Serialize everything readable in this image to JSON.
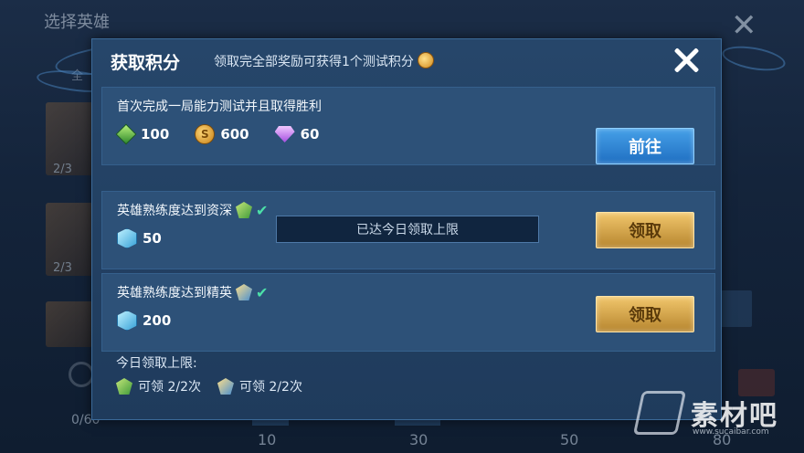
{
  "background": {
    "title": "选择英雄",
    "tab_partial": "全",
    "card_counts": [
      "2/3",
      "2/3"
    ],
    "progress_left": "0/60",
    "scale_labels": [
      "10",
      "30",
      "50",
      "80"
    ]
  },
  "dialog": {
    "title": "获取积分",
    "subtitle": "领取完全部奖励可获得1个测试积分",
    "tasks": [
      {
        "title": "首次完成一局能力测试并且取得胜利",
        "rewards": [
          {
            "icon": "green-gem-icon",
            "amount": "100"
          },
          {
            "icon": "gold-coin-icon",
            "amount": "600"
          },
          {
            "icon": "purple-diamond-icon",
            "amount": "60"
          }
        ],
        "button": "前往",
        "button_style": "blue"
      },
      {
        "title": "英雄熟练度达到资深",
        "badge_icon": "veteran-badge-icon",
        "completed": true,
        "rewards": [
          {
            "icon": "blue-crystal-icon",
            "amount": "50"
          }
        ],
        "button": "领取",
        "button_style": "gold"
      },
      {
        "title": "英雄熟练度达到精英",
        "badge_icon": "elite-badge-icon",
        "completed": true,
        "rewards": [
          {
            "icon": "blue-crystal-icon",
            "amount": "200"
          }
        ],
        "button": "领取",
        "button_style": "gold"
      }
    ],
    "toast": "已达今日领取上限",
    "limit_title": "今日领取上限:",
    "limits": [
      {
        "icon": "veteran-badge-icon",
        "text": "可领 2/2次"
      },
      {
        "icon": "elite-badge-icon",
        "text": "可领 2/2次"
      }
    ]
  },
  "watermark": {
    "brand": "素材吧",
    "url": "www.sucaibar.com"
  },
  "colors": {
    "dialog_bg": "#26466a",
    "row_bg": "#2d5178",
    "button_blue": "#1f6fc2",
    "button_gold": "#d4a24a",
    "check_green": "#4ce0a8"
  }
}
